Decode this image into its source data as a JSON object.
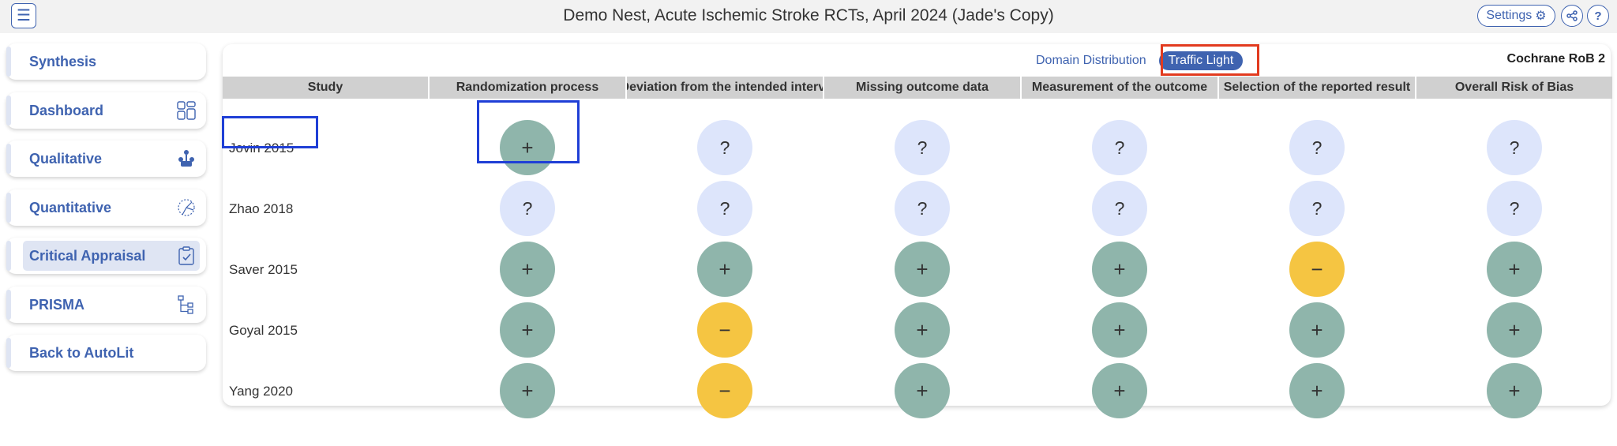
{
  "header": {
    "title": "Demo Nest, Acute Ischemic Stroke RCTs, April 2024 (Jade's Copy)",
    "menu_icon": "☰",
    "settings_label": "Settings",
    "settings_icon": "⚙",
    "share_icon": "<",
    "help_icon": "?"
  },
  "sidebar": {
    "items": [
      {
        "label": "Synthesis",
        "icon": ""
      },
      {
        "label": "Dashboard",
        "icon": "dashboard-icon"
      },
      {
        "label": "Qualitative",
        "icon": "qualitative-icon"
      },
      {
        "label": "Quantitative",
        "icon": "quantitative-icon"
      },
      {
        "label": "Critical Appraisal",
        "icon": "clipboard-check-icon",
        "active": true
      },
      {
        "label": "PRISMA",
        "icon": "flow-tree-icon"
      },
      {
        "label": "Back to AutoLit",
        "icon": ""
      }
    ]
  },
  "tabs": [
    {
      "label": "Domain Distribution",
      "active": false
    },
    {
      "label": "Traffic Light",
      "active": true
    }
  ],
  "rob_label": "Cochrane RoB 2",
  "table": {
    "columns": [
      "Study",
      "Randomization process",
      "Deviation from the intended interventions",
      "Missing outcome data",
      "Measurement of the outcome",
      "Selection of the reported result",
      "Overall Risk of Bias"
    ],
    "rows": [
      {
        "study": "Jovin 2015",
        "ratings": [
          "+",
          "?",
          "?",
          "?",
          "?",
          "?"
        ]
      },
      {
        "study": "Zhao 2018",
        "ratings": [
          "?",
          "?",
          "?",
          "?",
          "?",
          "?"
        ]
      },
      {
        "study": "Saver 2015",
        "ratings": [
          "+",
          "+",
          "+",
          "+",
          "−",
          "+"
        ]
      },
      {
        "study": "Goyal 2015",
        "ratings": [
          "+",
          "−",
          "+",
          "+",
          "+",
          "+"
        ]
      },
      {
        "study": "Yang 2020",
        "ratings": [
          "+",
          "−",
          "+",
          "+",
          "+",
          "+"
        ]
      }
    ]
  },
  "colors": {
    "accent": "#3f63b0",
    "low_risk": "#8fb5ab",
    "some_concerns": "#f5c542",
    "unclear": "#dde5fb",
    "highlight_red": "#e23b1f",
    "highlight_blue": "#1f3fd6"
  }
}
